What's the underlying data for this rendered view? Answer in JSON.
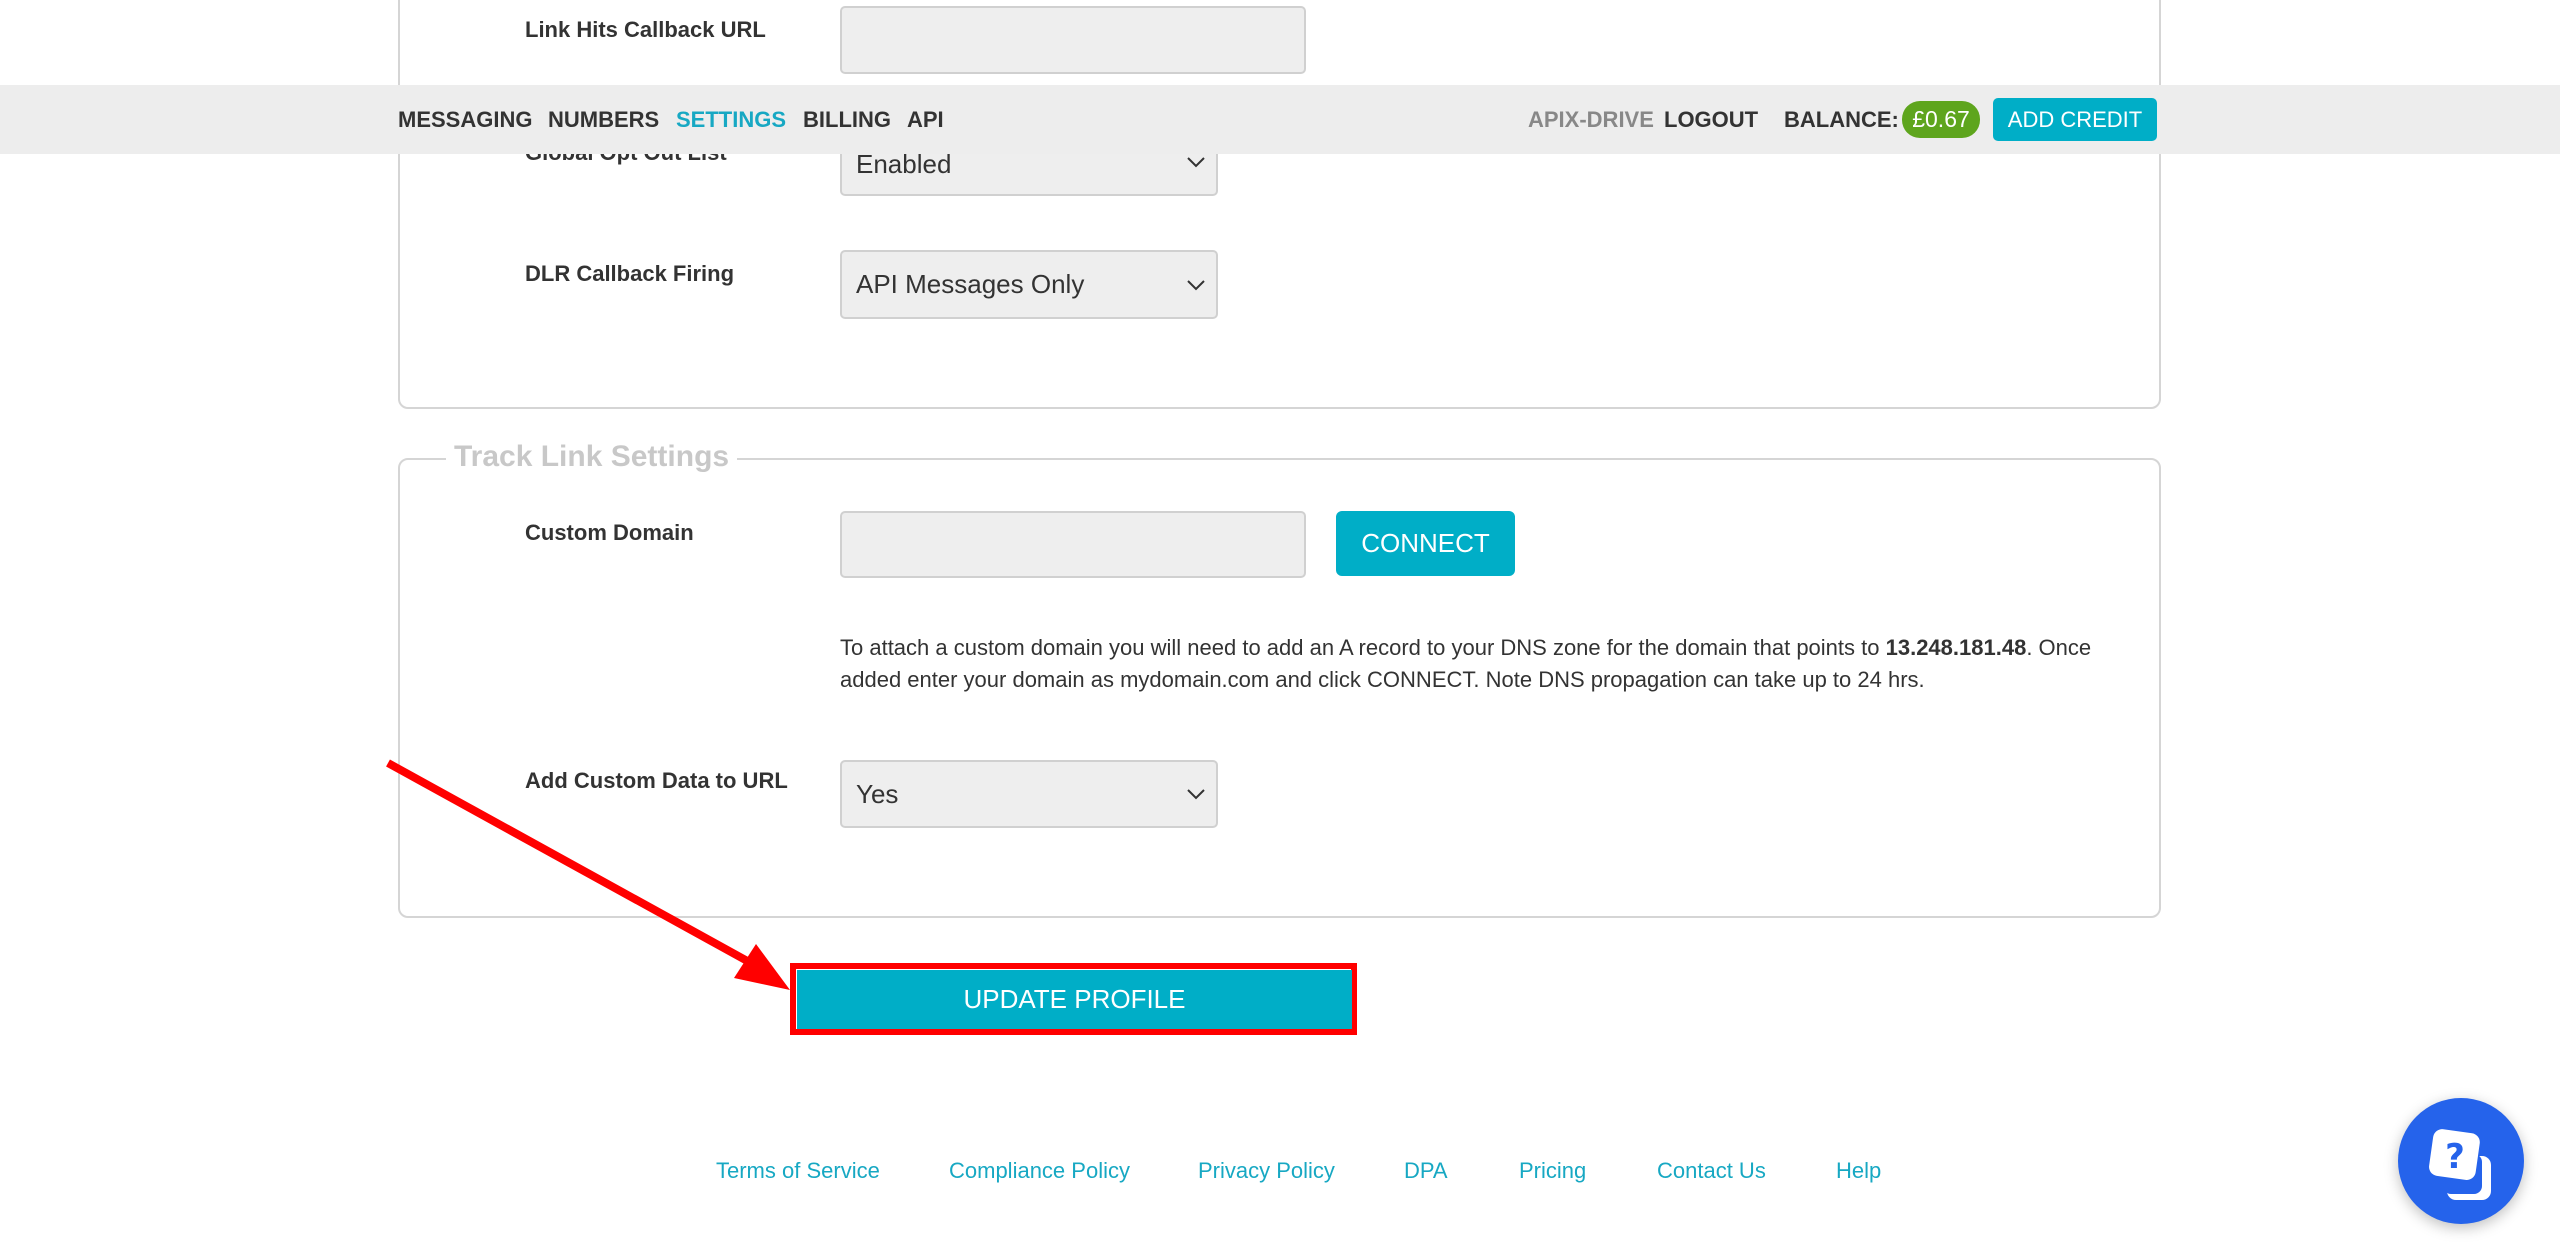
{
  "navbar": {
    "items": [
      {
        "label": "MESSAGING",
        "active": false
      },
      {
        "label": "NUMBERS",
        "active": false
      },
      {
        "label": "SETTINGS",
        "active": true
      },
      {
        "label": "BILLING",
        "active": false
      },
      {
        "label": "API",
        "active": false
      }
    ],
    "account_name": "APIX-DRIVE",
    "logout_label": "LOGOUT",
    "balance_label": "BALANCE:",
    "balance_value": "£0.67",
    "add_credit_label": "ADD CREDIT",
    "colors": {
      "active": "#17a8c3",
      "balance_badge": "#5ea51d",
      "add_credit": "#00aec7"
    }
  },
  "settings_card": {
    "fields": {
      "link_hits_callback_url": {
        "label": "Link Hits Callback URL",
        "value": ""
      },
      "global_opt_out_list": {
        "label": "Global Opt Out List",
        "value": "Enabled"
      },
      "dlr_callback_firing": {
        "label": "DLR Callback Firing",
        "value": "API Messages Only"
      }
    }
  },
  "track_link_settings": {
    "legend": "Track Link Settings",
    "custom_domain": {
      "label": "Custom Domain",
      "value": "",
      "connect_label": "CONNECT"
    },
    "info": {
      "before_ip": "To attach a custom domain you will need to add an A record to your DNS zone for the domain that points to ",
      "ip": "13.248.181.48",
      "after_ip": ". Once added enter your domain as mydomain.com and click CONNECT. Note DNS propagation can take up to 24 hrs."
    },
    "add_custom_data": {
      "label": "Add Custom Data to URL",
      "value": "Yes"
    }
  },
  "update_profile_label": "UPDATE PROFILE",
  "footer": {
    "links": [
      "Terms of Service",
      "Compliance Policy",
      "Privacy Policy",
      "DPA",
      "Pricing",
      "Contact Us",
      "Help"
    ]
  },
  "help_widget": {
    "icon": "help-chat-icon"
  },
  "annotation": {
    "type": "red-arrow-highlight",
    "target": "update-profile-button",
    "color": "#ff0000"
  }
}
